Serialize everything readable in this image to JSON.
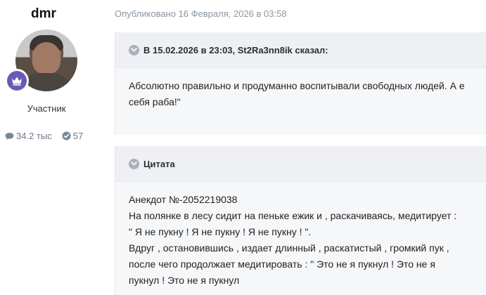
{
  "author": {
    "name": "dmr",
    "rank": "Участник",
    "reputation": "34.2 тыс",
    "solutions": "57"
  },
  "post": {
    "published": "Опубликовано 16 Февраля, 2026 в 03:58"
  },
  "quotes": [
    {
      "header": "В 15.02.2026 в 23:03, St2Ra3nn8ik сказал:",
      "lines": [
        "Абсолютно правильно и продуманно воспитывали свободных людей. А е",
        "себя раба!\""
      ]
    },
    {
      "header": "Цитата",
      "lines": [
        "Анекдот №-2052219038",
        "На полянке в лесу сидит на пеньке ежик и , раскачиваясь, медитирует :",
        "\" Я не пукну ! Я не пукну ! Я не пукну ! \".",
        "Вдруг , остановившись , издает длинный , раскатистый , громкий пук ,",
        "после чего продолжает медитировать : \" Это не я пукнул ! Это не я",
        "пукнул ! Это не я пукнул"
      ]
    }
  ],
  "icons": {
    "reputation": "comment-icon",
    "solutions": "check-circle-icon",
    "rank": "crown-icon",
    "quote_toggle": "chevron-down-icon"
  },
  "colors": {
    "rank_badge": "#6b5ab5",
    "muted_text": "#8a96a3",
    "quote_bg": "#f6f7f9",
    "quote_header_bg": "#eef0f3"
  }
}
